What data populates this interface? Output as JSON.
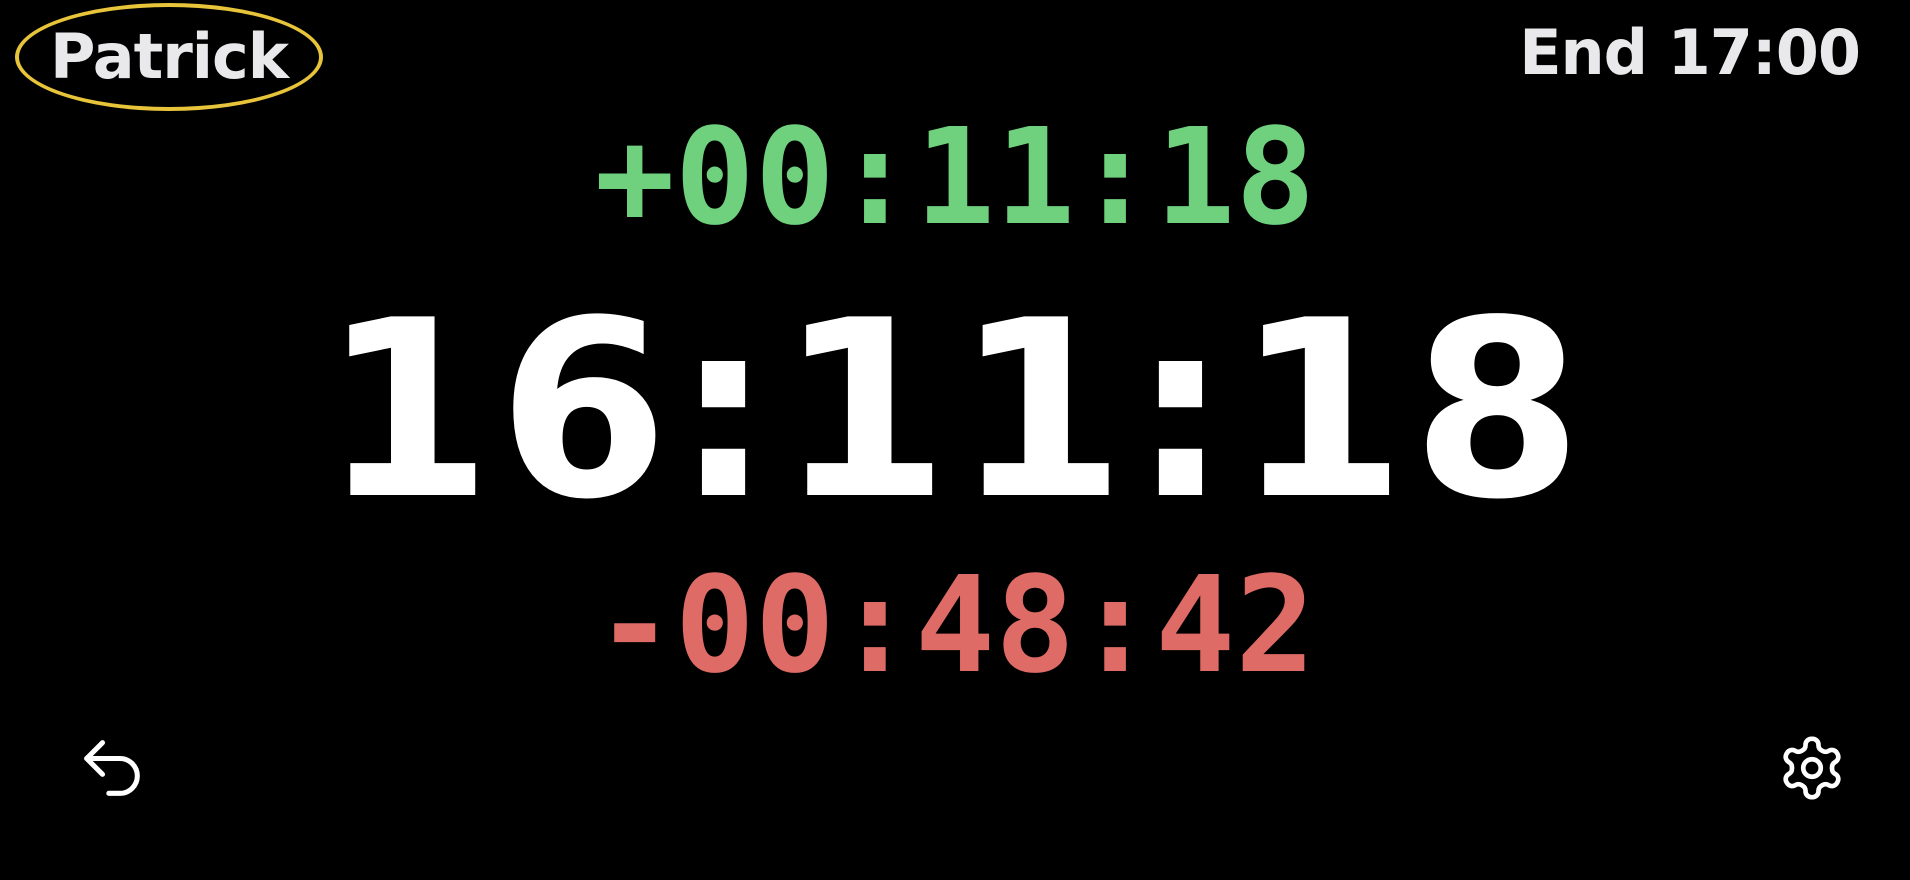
{
  "header": {
    "user_name": "Patrick",
    "end_label": "End 17:00"
  },
  "timers": {
    "elapsed": "+00:11:18",
    "current_time": "16:11:18",
    "remaining": "-00:48:42"
  },
  "controls": {
    "undo_icon": "undo-icon",
    "settings_icon": "gear-icon"
  },
  "colors": {
    "background": "#000000",
    "badge_border": "#e7c43a",
    "elapsed": "#6fd07e",
    "clock": "#ffffff",
    "remaining": "#df6b66",
    "header_text": "#e9e9ec"
  }
}
